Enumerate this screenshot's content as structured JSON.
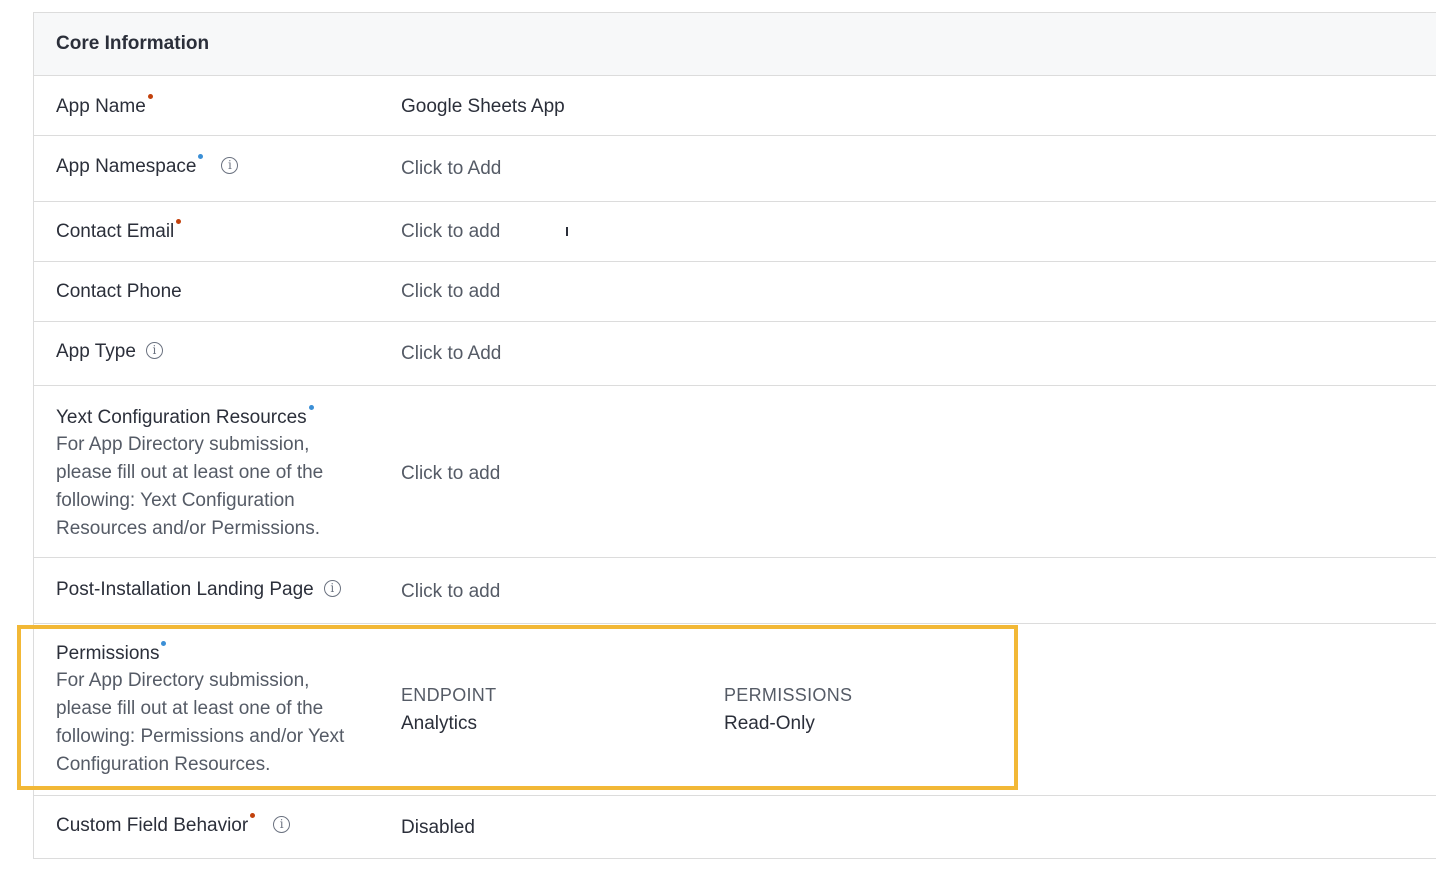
{
  "section": {
    "title": "Core Information"
  },
  "rows": {
    "app_name": {
      "label": "App Name",
      "value": "Google Sheets App"
    },
    "app_namespace": {
      "label": "App Namespace",
      "value": "Click to Add"
    },
    "contact_email": {
      "label": "Contact Email",
      "value": "Click to add"
    },
    "contact_phone": {
      "label": "Contact Phone",
      "value": "Click to add"
    },
    "app_type": {
      "label": "App Type",
      "value": "Click to Add"
    },
    "yext_config": {
      "label": "Yext Configuration Resources",
      "description": "For App Directory submission, please fill out at least one of the following: Yext Configuration Resources and/or Permissions.",
      "value": "Click to add"
    },
    "landing_page": {
      "label": "Post-Installation Landing Page",
      "value": "Click to add"
    },
    "permissions": {
      "label": "Permissions",
      "description": "For App Directory submission, please fill out at least one of the following: Permissions and/or Yext Configuration Resources.",
      "endpoint_header": "ENDPOINT",
      "permissions_header": "PERMISSIONS",
      "endpoint_value": "Analytics",
      "permission_value": "Read-Only"
    },
    "custom_field": {
      "label": "Custom Field Behavior",
      "value": "Disabled"
    }
  },
  "colors": {
    "required_marker": "#c2410c",
    "optional_marker": "#3b8fd6",
    "highlight": "#f2b836"
  },
  "icons": {
    "info": "info-circle-icon"
  }
}
